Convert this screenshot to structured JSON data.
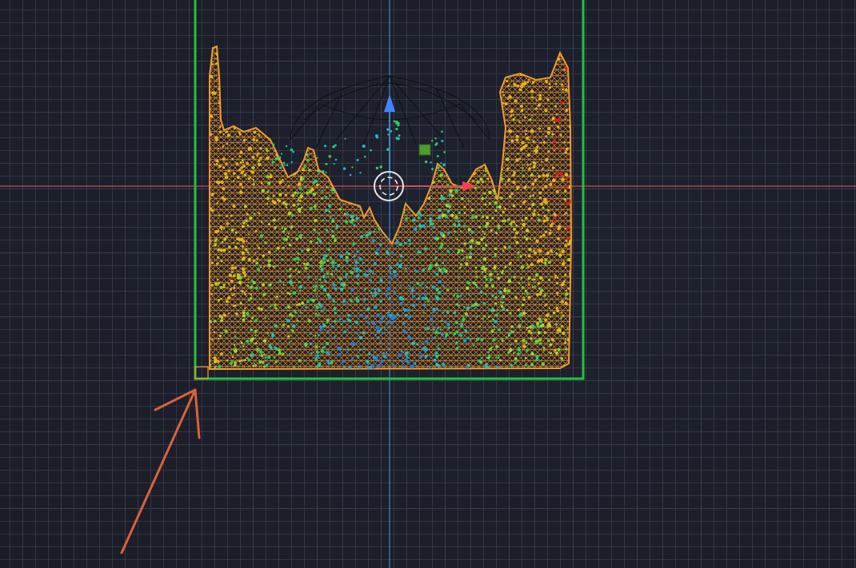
{
  "viewport": {
    "grid": true,
    "icons": [
      "x-axis-line",
      "z-axis-line",
      "domain-bounding-box",
      "fluid-particles",
      "emitter-sphere-wireframe",
      "z-arrow-gizmo",
      "x-arrow-gizmo",
      "pivot-circle-gizmo",
      "origin-corner-marker",
      "annotation-arrow"
    ]
  },
  "colors": {
    "x_axis": "#c44b5c",
    "z_axis": "#3f86c8",
    "domain_box": "#22c23c",
    "mesh": "#f19a2c",
    "particle_low": "#1f7fe0",
    "particle_mid": "#2ccf5a",
    "particle_high": "#e21a1a",
    "annotation": "#d8623c"
  }
}
